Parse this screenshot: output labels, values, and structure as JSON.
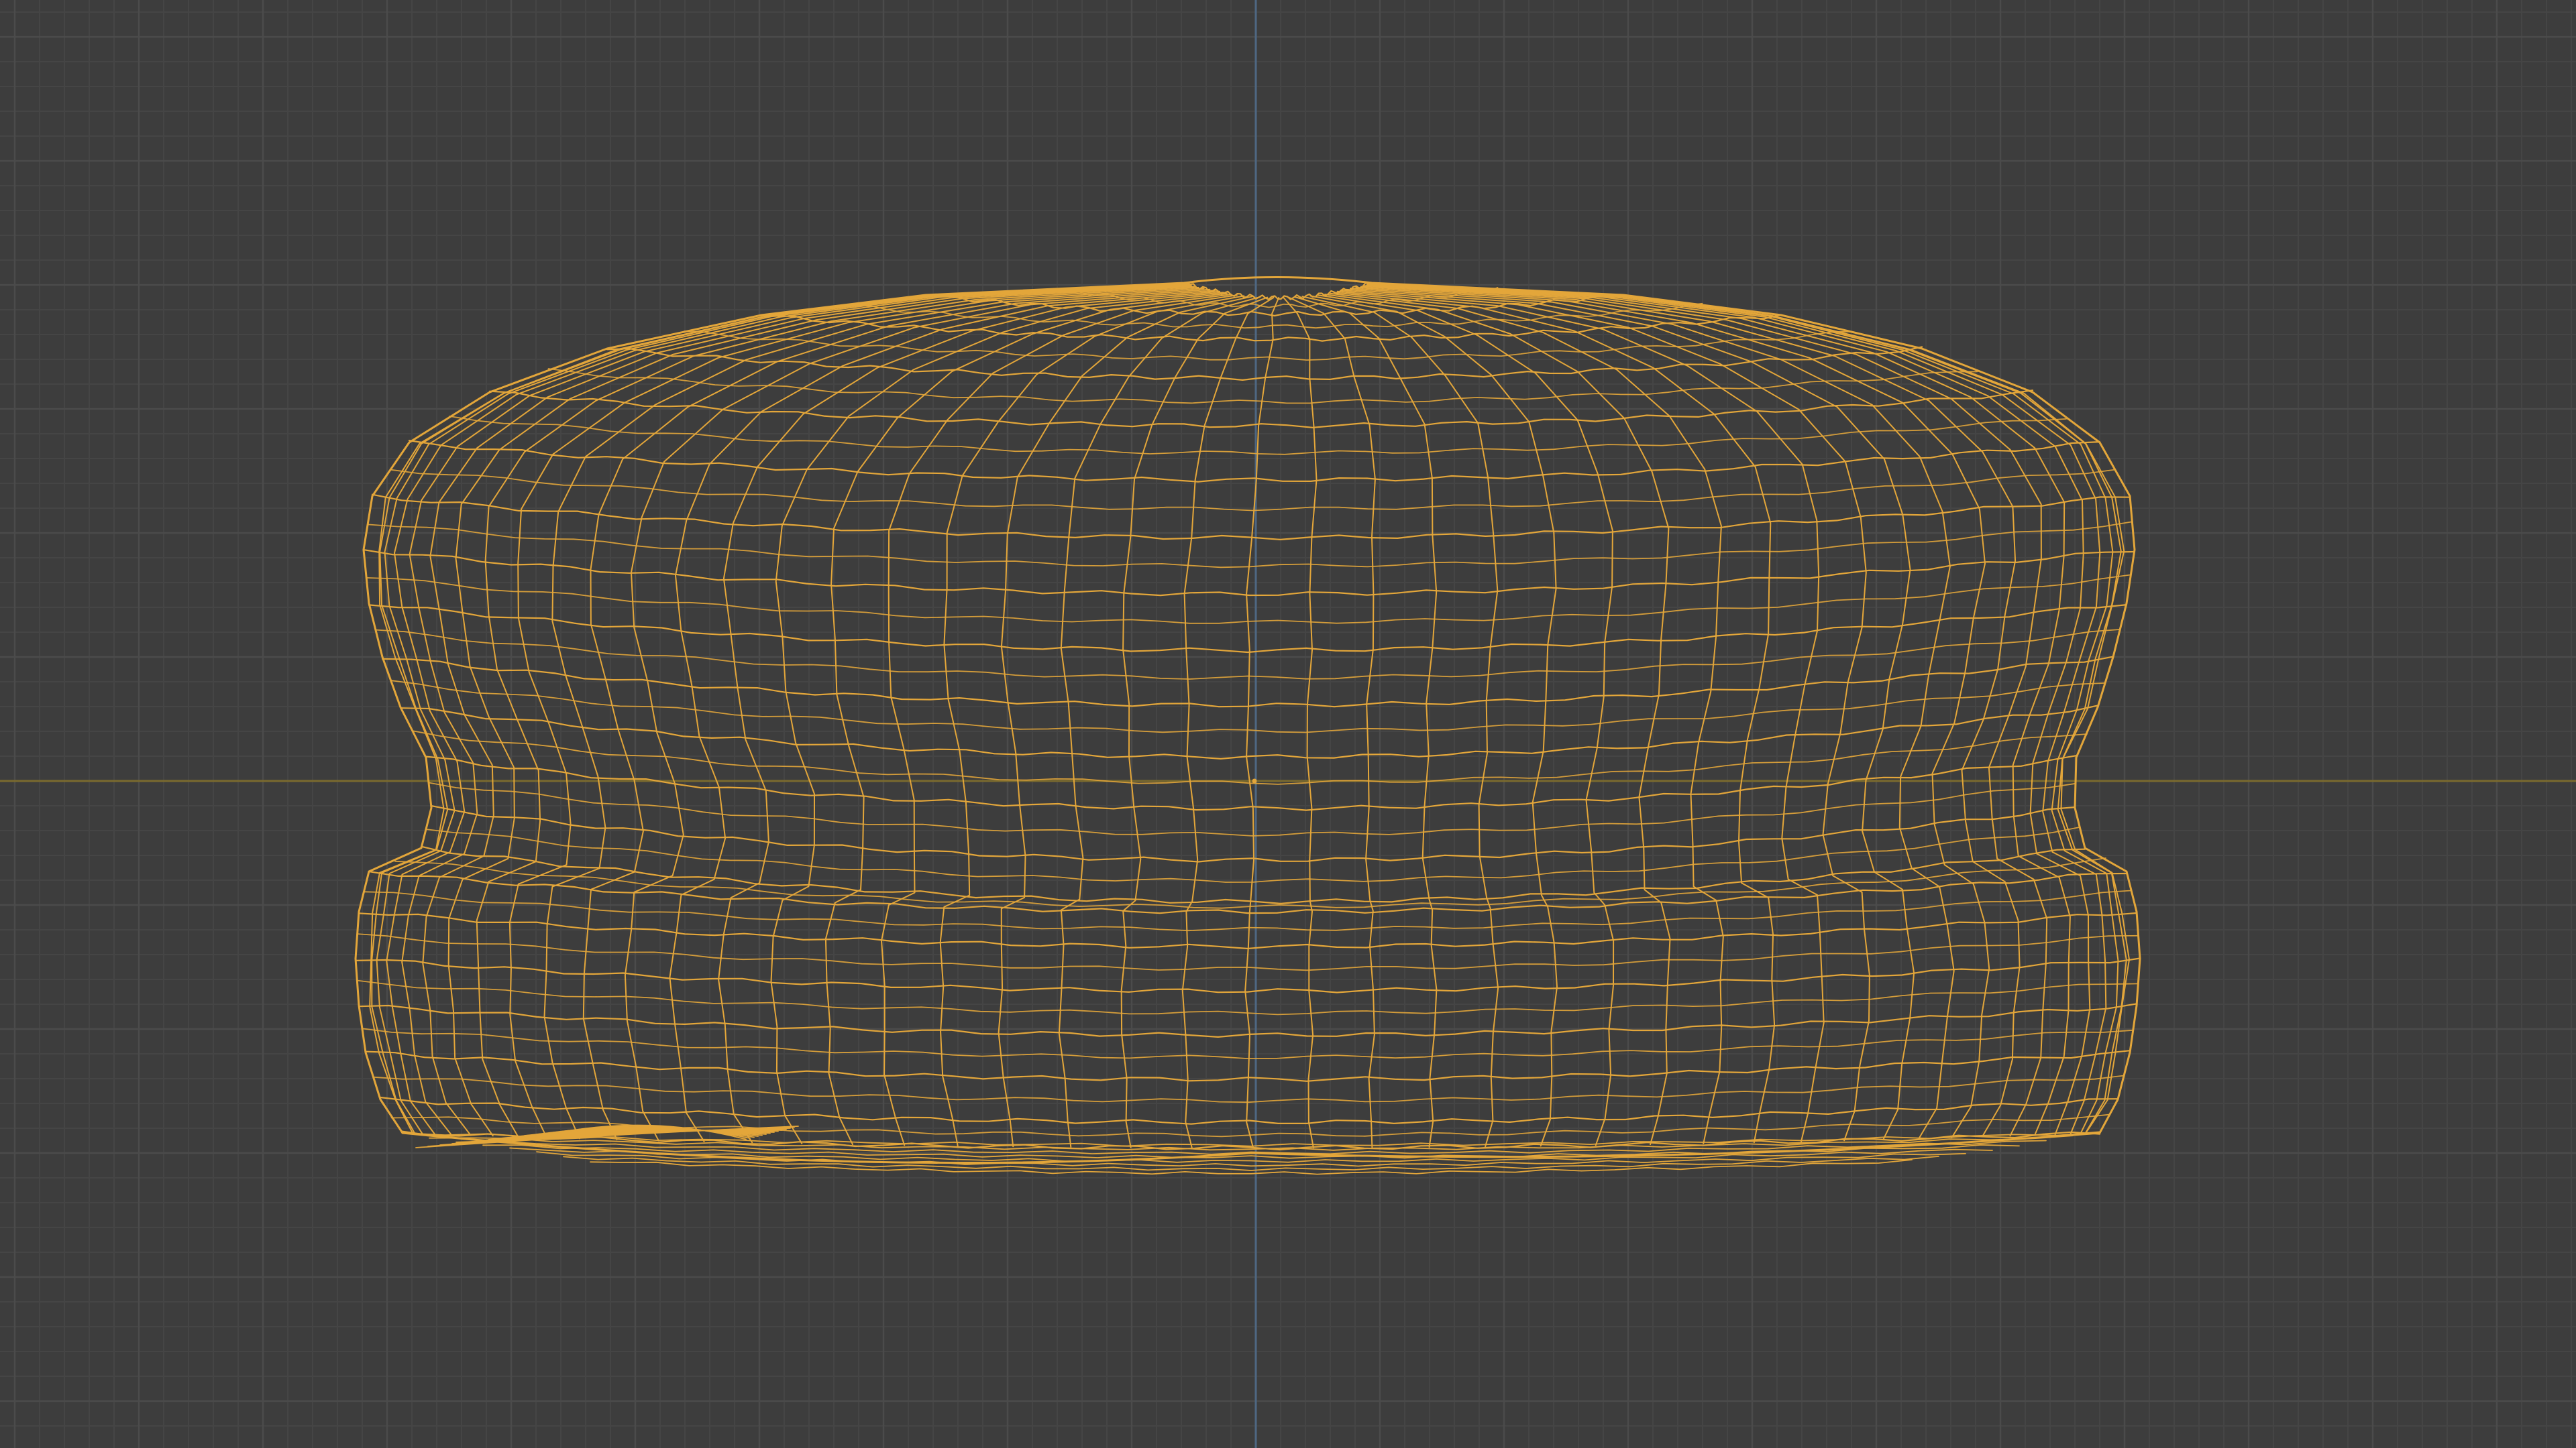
{
  "viewport": {
    "background_color": "#3d3d3d",
    "grid_minor_color": "#454545",
    "grid_major_color": "#4b4b4b",
    "axis_x_color": "#7a6a2e",
    "axis_z_color": "#4e6782",
    "wireframe_color": "#e3a63a",
    "origin_color": "#e3a63a"
  },
  "object": {
    "icon": "wireframe-mesh-icon",
    "shape": "burger bun wireframe",
    "selected": true
  }
}
